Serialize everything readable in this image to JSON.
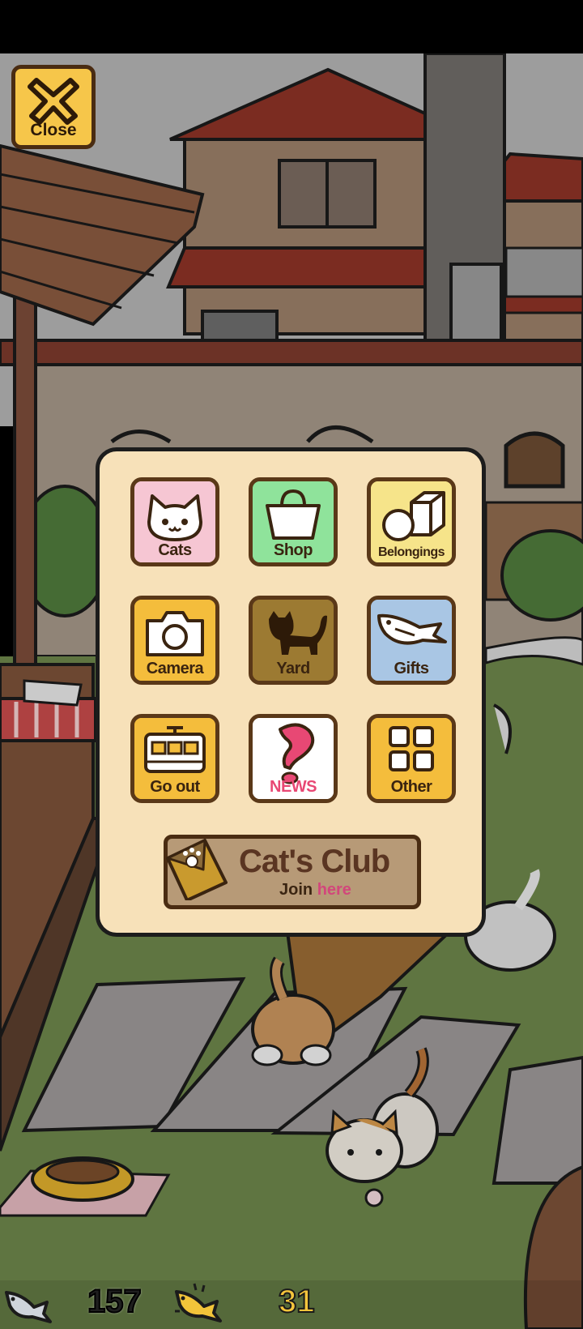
{
  "close_button": {
    "label": "Close"
  },
  "menu": {
    "tiles": [
      {
        "label": "Cats",
        "icon": "cat-face-icon",
        "color": "#f6c6d3"
      },
      {
        "label": "Shop",
        "icon": "shopping-bag-icon",
        "color": "#8fe39b"
      },
      {
        "label": "Belongings",
        "icon": "ball-and-box-icon",
        "color": "#f6e48a"
      },
      {
        "label": "Camera",
        "icon": "camera-icon",
        "color": "#f4bd3c"
      },
      {
        "label": "Yard",
        "icon": "cat-silhouette-icon",
        "color": "#9c7a32"
      },
      {
        "label": "Gifts",
        "icon": "fish-icon",
        "color": "#a9c6e4"
      },
      {
        "label": "Go out",
        "icon": "train-icon",
        "color": "#f4bd3c"
      },
      {
        "label": "NEWS",
        "icon": "exclamation-icon",
        "color": "#ffffff"
      },
      {
        "label": "Other",
        "icon": "four-squares-icon",
        "color": "#f4bd3c"
      }
    ],
    "club": {
      "title": "Cat's Club",
      "join_prefix": "Join",
      "join_link": "here"
    }
  },
  "currency": {
    "silver_fish": {
      "value": "157",
      "icon": "silver-fish-icon",
      "color": "#1e1e1e"
    },
    "gold_fish": {
      "value": "31",
      "icon": "gold-fish-icon",
      "color": "#f5c53c"
    }
  }
}
